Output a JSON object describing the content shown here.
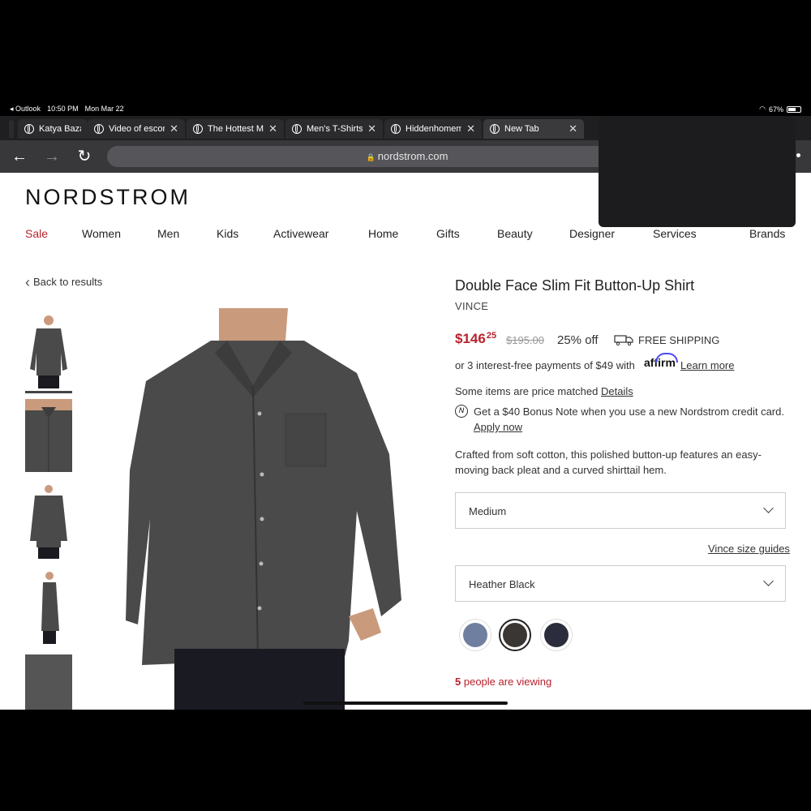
{
  "status_bar": {
    "back_app": "Outlook",
    "time": "10:50 PM",
    "date": "Mon Mar 22",
    "battery": "67%",
    "battery_level": 0.67
  },
  "tabs": [
    {
      "title": "Katya Baza"
    },
    {
      "title": "Video of escort"
    },
    {
      "title": "The Hottest Me"
    },
    {
      "title": "Men's T-Shirts"
    },
    {
      "title": "Hiddenhomem"
    },
    {
      "title": "New Tab"
    }
  ],
  "url": "nordstrom.com",
  "site": {
    "logo": "NORDSTROM",
    "nav": [
      "Sale",
      "Women",
      "Men",
      "Kids",
      "Activewear",
      "Home",
      "Gifts",
      "Beauty",
      "Designer",
      "Services",
      "Brands"
    ]
  },
  "back_link": "Back to results",
  "product": {
    "title": "Double Face Slim Fit Button-Up Shirt",
    "brand": "VINCE",
    "price_dollars": "$146",
    "price_cents": "25",
    "original_price": "$195.00",
    "discount": "25% off",
    "shipping": "FREE SHIPPING",
    "installments": "or 3 interest-free payments of $49 with",
    "affirm": "affirm",
    "learn_more": "Learn more",
    "price_match": "Some items are price matched",
    "details_link": "Details",
    "bonus_note": "Get a $40 Bonus Note when you use a new Nordstrom credit card.",
    "apply_now": "Apply now",
    "description": "Crafted from soft cotton, this polished button-up features an easy-moving back pleat and a curved shirttail hem.",
    "size_value": "Medium",
    "size_guide": "Vince size guides",
    "color_value": "Heather Black",
    "swatches": [
      {
        "name": "blue",
        "color": "#6f7fa0"
      },
      {
        "name": "heather-black",
        "color": "#3a3634"
      },
      {
        "name": "navy",
        "color": "#2b2d3c"
      }
    ],
    "viewers_count": "5",
    "viewers_text": "people are viewing"
  },
  "colors": {
    "accent_red": "#b8222c",
    "shirt": "#4a4a4a"
  }
}
